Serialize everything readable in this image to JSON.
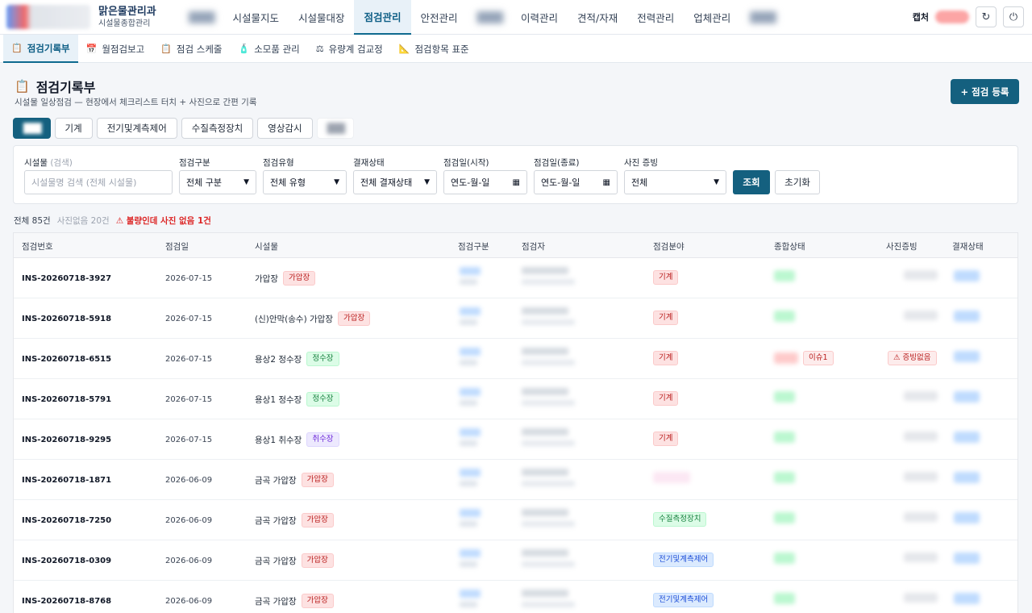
{
  "header": {
    "org_title": "맑은물관리과",
    "org_subtitle": "시설물종합관리",
    "nav": [
      {
        "label": "",
        "blurred": true
      },
      {
        "label": "시설물지도"
      },
      {
        "label": "시설물대장"
      },
      {
        "label": "점검관리",
        "active": true
      },
      {
        "label": "안전관리"
      },
      {
        "label": "",
        "blurred": true
      },
      {
        "label": "이력관리"
      },
      {
        "label": "견적/자재"
      },
      {
        "label": "전력관리"
      },
      {
        "label": "업체관리"
      },
      {
        "label": "",
        "blurred": true
      }
    ],
    "user_name": "캡처"
  },
  "subnav": [
    {
      "label": "점검기록부",
      "icon": "clipboard-icon",
      "active": true
    },
    {
      "label": "월점검보고",
      "icon": "calendar-icon"
    },
    {
      "label": "점검 스케줄",
      "icon": "clipboard-icon"
    },
    {
      "label": "소모품 관리",
      "icon": "bottle-icon"
    },
    {
      "label": "유량계 검교정",
      "icon": "scale-icon"
    },
    {
      "label": "점검항목 표준",
      "icon": "ruler-icon"
    }
  ],
  "page": {
    "title": "점검기록부",
    "description": "시설물 일상점검 — 현장에서 체크리스트 터치 + 사진으로 간편 기록",
    "add_button": "+ 점검 등록"
  },
  "category_tabs": [
    {
      "label": "",
      "active": true,
      "blurred": true
    },
    {
      "label": "기계"
    },
    {
      "label": "전기및계측제어"
    },
    {
      "label": "수질측정장치"
    },
    {
      "label": "영상감시"
    },
    {
      "label": "",
      "faded": true
    }
  ],
  "filters": {
    "facility": {
      "label": "시설물",
      "hint": "(검색)",
      "placeholder": "시설물명 검색 (전체 시설물)"
    },
    "division": {
      "label": "점검구분",
      "value": "전체 구분"
    },
    "type": {
      "label": "점검유형",
      "value": "전체 유형"
    },
    "approval": {
      "label": "결재상태",
      "value": "전체 결재상태"
    },
    "date_start": {
      "label": "점검일(시작)",
      "value": "연도-월-일"
    },
    "date_end": {
      "label": "점검일(종료)",
      "value": "연도-월-일"
    },
    "photo": {
      "label": "사진 증빙",
      "value": "전체"
    },
    "search_button": "조회",
    "reset_button": "초기화"
  },
  "counts": {
    "total": "전체 85건",
    "no_photo": "사진없음 20건",
    "warning": "⚠ 불량인데 사진 없음 1건"
  },
  "table": {
    "columns": [
      "점검번호",
      "점검일",
      "시설물",
      "점검구분",
      "점검자",
      "점검분야",
      "종합상태",
      "사진증빙",
      "결재상태"
    ],
    "rows": [
      {
        "no": "INS-20260718-3927",
        "date": "2026-07-15",
        "facility": "가압장",
        "facility_tag": "가압장",
        "tag_color": "red",
        "area": "기계",
        "area_color": "red",
        "status": "ok",
        "photo_label": ""
      },
      {
        "no": "INS-20260718-5918",
        "date": "2026-07-15",
        "facility": "(신)안막(송수) 가압장",
        "facility_tag": "가압장",
        "tag_color": "red",
        "area": "기계",
        "area_color": "red",
        "status": "ok",
        "photo_label": ""
      },
      {
        "no": "INS-20260718-6515",
        "date": "2026-07-15",
        "facility": "용상2 정수장",
        "facility_tag": "정수장",
        "tag_color": "green",
        "area": "기계",
        "area_color": "red",
        "status": "bad",
        "issue": "이슈1",
        "photo_label": "⚠ 증빙없음"
      },
      {
        "no": "INS-20260718-5791",
        "date": "2026-07-15",
        "facility": "용상1 정수장",
        "facility_tag": "정수장",
        "tag_color": "green",
        "area": "기계",
        "area_color": "red",
        "status": "ok",
        "photo_label": ""
      },
      {
        "no": "INS-20260718-9295",
        "date": "2026-07-15",
        "facility": "용상1 취수장",
        "facility_tag": "취수장",
        "tag_color": "purple",
        "area": "기계",
        "area_color": "red",
        "status": "ok",
        "photo_label": ""
      },
      {
        "no": "INS-20260718-1871",
        "date": "2026-06-09",
        "facility": "금곡 가압장",
        "facility_tag": "가압장",
        "tag_color": "red",
        "area": "",
        "area_color": "pink",
        "status": "ok",
        "photo_label": ""
      },
      {
        "no": "INS-20260718-7250",
        "date": "2026-06-09",
        "facility": "금곡 가압장",
        "facility_tag": "가압장",
        "tag_color": "red",
        "area": "수질측정장치",
        "area_color": "green",
        "status": "ok",
        "photo_label": ""
      },
      {
        "no": "INS-20260718-0309",
        "date": "2026-06-09",
        "facility": "금곡 가압장",
        "facility_tag": "가압장",
        "tag_color": "red",
        "area": "전기및계측제어",
        "area_color": "blue",
        "status": "ok",
        "photo_label": ""
      },
      {
        "no": "INS-20260718-8768",
        "date": "2026-06-09",
        "facility": "금곡 가압장",
        "facility_tag": "가압장",
        "tag_color": "red",
        "area": "전기및계측제어",
        "area_color": "blue",
        "status": "ok",
        "photo_label": ""
      }
    ]
  }
}
